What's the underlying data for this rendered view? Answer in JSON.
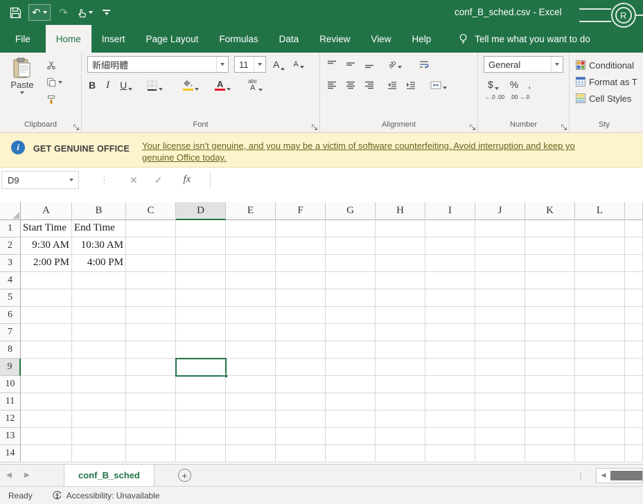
{
  "titlebar": {
    "title": "conf_B_sched.csv - Excel"
  },
  "tabs": {
    "items": [
      {
        "label": "File",
        "active": false
      },
      {
        "label": "Home",
        "active": true
      },
      {
        "label": "Insert",
        "active": false
      },
      {
        "label": "Page Layout",
        "active": false
      },
      {
        "label": "Formulas",
        "active": false
      },
      {
        "label": "Data",
        "active": false
      },
      {
        "label": "Review",
        "active": false
      },
      {
        "label": "View",
        "active": false
      },
      {
        "label": "Help",
        "active": false
      }
    ],
    "tell_me": "Tell me what you want to do"
  },
  "ribbon": {
    "clipboard": {
      "paste_label": "Paste",
      "group_label": "Clipboard"
    },
    "font": {
      "font_name": "新細明體",
      "font_size": "11",
      "grow": "A",
      "shrink": "A",
      "bold": "B",
      "italic": "I",
      "underline": "U",
      "font_color_letter": "A",
      "phonetic": "abc",
      "group_label": "Font"
    },
    "alignment": {
      "orientation": "ab",
      "group_label": "Alignment"
    },
    "number": {
      "format": "General",
      "currency": "$",
      "percent": "%",
      "comma": ",",
      "inc_decimal": "←.0 .00",
      "dec_decimal": ".00 →.0",
      "group_label": "Number"
    },
    "styles": {
      "conditional": "Conditional",
      "format_as_table": "Format as T",
      "cell_styles": "Cell Styles",
      "group_label": "Sty"
    }
  },
  "message_bar": {
    "badge": "GET GENUINE OFFICE",
    "link_line1": "Your license isn't genuine, and you may be a victim of software counterfeiting. Avoid interruption and keep yo",
    "link_line2": "genuine Office today."
  },
  "formula_bar": {
    "name_box": "D9",
    "fx": "fx",
    "formula": ""
  },
  "grid": {
    "columns": [
      "A",
      "B",
      "C",
      "D",
      "E",
      "F",
      "G",
      "H",
      "I",
      "J",
      "K",
      "L"
    ],
    "row_start": 1,
    "row_count": 14,
    "cells": [
      {
        "ref": "A1",
        "col": "A",
        "row": 1,
        "text": "Start Time",
        "align": "left"
      },
      {
        "ref": "B1",
        "col": "B",
        "row": 1,
        "text": "End Time",
        "align": "left"
      },
      {
        "ref": "A2",
        "col": "A",
        "row": 2,
        "text": "9:30 AM",
        "align": "right"
      },
      {
        "ref": "B2",
        "col": "B",
        "row": 2,
        "text": "10:30 AM",
        "align": "right"
      },
      {
        "ref": "A3",
        "col": "A",
        "row": 3,
        "text": "2:00 PM",
        "align": "right"
      },
      {
        "ref": "B3",
        "col": "B",
        "row": 3,
        "text": "4:00 PM",
        "align": "right"
      }
    ],
    "selection": {
      "ref": "D9",
      "col": "D",
      "row": 9
    }
  },
  "sheet_bar": {
    "tab": "conf_B_sched"
  },
  "status_bar": {
    "mode": "Ready",
    "accessibility": "Accessibility: Unavailable"
  },
  "glyphs": {
    "undo": "↶",
    "redo": "↷",
    "cancel": "✕",
    "check": "✓",
    "dots": "⋮",
    "prev": "◀",
    "next": "▶",
    "plus": "+",
    "info": "i"
  },
  "colors": {
    "excel_green": "#217346",
    "message_bg": "#fdf4cd",
    "selection_border": "#217346",
    "fill_color_bar": "#f2c811",
    "font_color_bar": "#e81123"
  }
}
